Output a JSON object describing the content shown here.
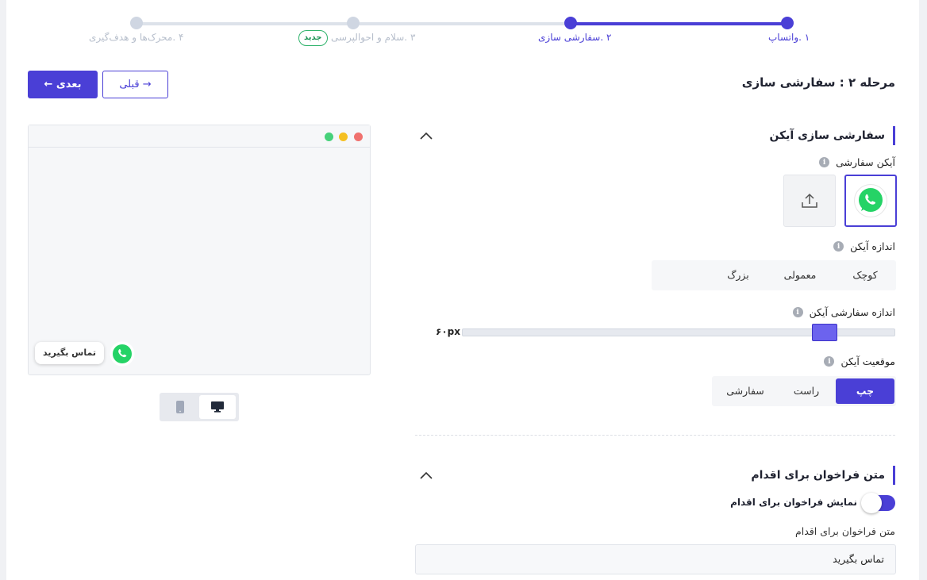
{
  "stepper": {
    "steps": [
      {
        "label": "۱ .واتساپ",
        "state": "active"
      },
      {
        "label": "۲ .سفارشی سازی",
        "state": "active"
      },
      {
        "label": "۳ .سلام و احوالپرسی",
        "state": "inactive",
        "badge": "جدید"
      },
      {
        "label": "۴ .محرک‌ها و هدف‌گیری",
        "state": "inactive"
      }
    ]
  },
  "header": {
    "stage_title": "مرحله ۲ : سفارشی سازی",
    "next_label": "بعدی ←",
    "prev_label": "→ قبلی"
  },
  "preview": {
    "chip_text": "تماس بگیرید",
    "window_dots": [
      "#f0716e",
      "#f5c022",
      "#46d17a"
    ],
    "device": {
      "selected": "desktop",
      "options": [
        "desktop-icon",
        "mobile-icon"
      ]
    }
  },
  "icon_section": {
    "title": "سفارشی سازی آیکن",
    "custom_icon_label": "آیکن سفارشی",
    "icon_size_label": "اندازه آیکن",
    "size_options": [
      "کوچک",
      "معمولی",
      "بزرگ"
    ],
    "custom_size_label": "اندازه سفارشی آیکن",
    "custom_size_value": "۶۰px",
    "position_label": "موقعیت آیکن",
    "position_options": [
      "چپ",
      "راست",
      "سفارشی"
    ],
    "position_selected": "چپ"
  },
  "cta_section": {
    "title": "متن فراخوان برای اقدام",
    "toggle_label": "نمایش فراخوان برای اقدام",
    "toggle_on": true,
    "text_label": "متن فراخوان برای اقدام",
    "text_value": "تماس بگیرید"
  },
  "colors": {
    "accent": "#4a3fd6",
    "whatsapp": "#25d366",
    "badge_green": "#2fb36b"
  }
}
